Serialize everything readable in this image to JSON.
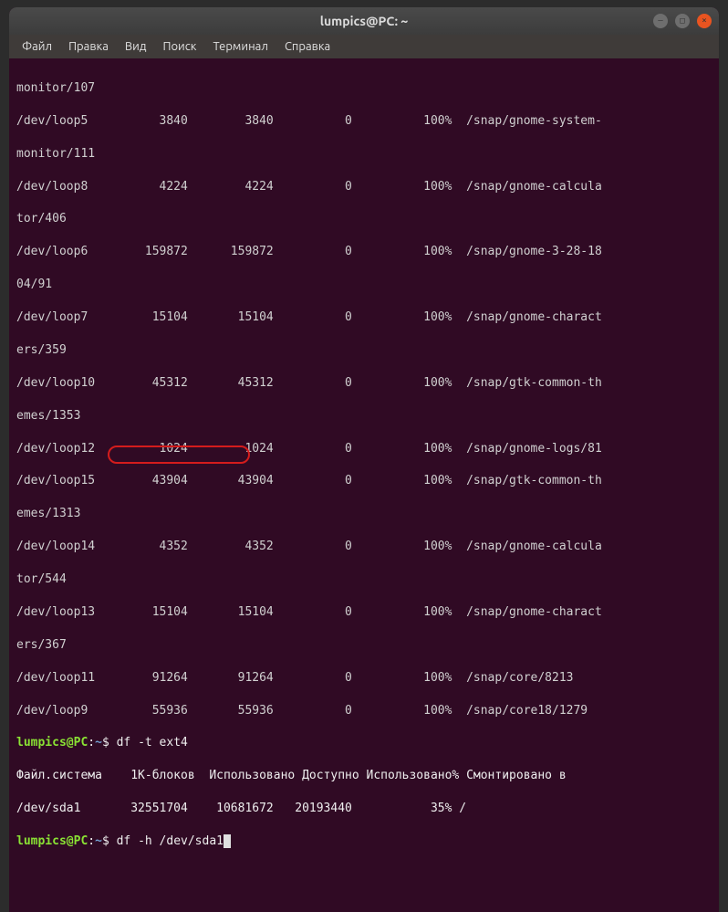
{
  "titlebar": {
    "title": "lumpics@PC: ~"
  },
  "menubar": {
    "items": [
      "Файл",
      "Правка",
      "Вид",
      "Поиск",
      "Терминал",
      "Справка"
    ]
  },
  "terminal": {
    "lines": [
      "monitor/107",
      "/dev/loop5          3840        3840          0          100%  /snap/gnome-system-",
      "monitor/111",
      "/dev/loop8          4224        4224          0          100%  /snap/gnome-calcula",
      "tor/406",
      "/dev/loop6        159872      159872          0          100%  /snap/gnome-3-28-18",
      "04/91",
      "/dev/loop7         15104       15104          0          100%  /snap/gnome-charact",
      "ers/359",
      "/dev/loop10        45312       45312          0          100%  /snap/gtk-common-th",
      "emes/1353",
      "/dev/loop12         1024        1024          0          100%  /snap/gnome-logs/81",
      "/dev/loop15        43904       43904          0          100%  /snap/gtk-common-th",
      "emes/1313",
      "/dev/loop14         4352        4352          0          100%  /snap/gnome-calcula",
      "tor/544",
      "/dev/loop13        15104       15104          0          100%  /snap/gnome-charact",
      "ers/367",
      "/dev/loop11        91264       91264          0          100%  /snap/core/8213",
      "/dev/loop9         55936       55936          0          100%  /snap/core18/1279"
    ],
    "prompt": {
      "user_host": "lumpics@PC",
      "colon": ":",
      "path": "~",
      "dollar": "$"
    },
    "command1": "df -t ext4",
    "header_line": "Файл.система    1K-блоков  Использовано Доступно Использовано% Cмонтировано в",
    "data_line": "/dev/sda1       32551704    10681672   20193440           35% /",
    "command2": "df -h /dev/sda1"
  }
}
